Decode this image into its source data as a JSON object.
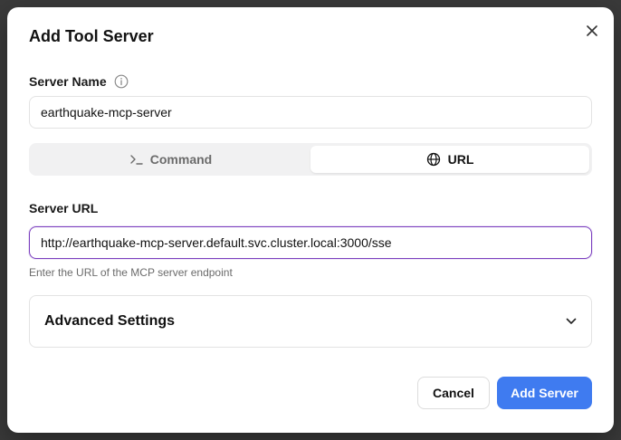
{
  "dialog": {
    "title": "Add Tool Server",
    "server_name": {
      "label": "Server Name",
      "value": "earthquake-mcp-server",
      "info_icon": "info-icon"
    },
    "transport_tabs": [
      {
        "label": "Command",
        "icon": "terminal-icon",
        "selected": false
      },
      {
        "label": "URL",
        "icon": "globe-icon",
        "selected": true
      }
    ],
    "server_url": {
      "label": "Server URL",
      "value": "http://earthquake-mcp-server.default.svc.cluster.local:3000/sse",
      "hint": "Enter the URL of the MCP server endpoint"
    },
    "advanced": {
      "title": "Advanced Settings",
      "icon": "chevron-down-icon"
    },
    "buttons": {
      "cancel": "Cancel",
      "add": "Add Server"
    },
    "colors": {
      "accent": "#3f7bf0",
      "focus_border": "#7b3fbf"
    }
  }
}
